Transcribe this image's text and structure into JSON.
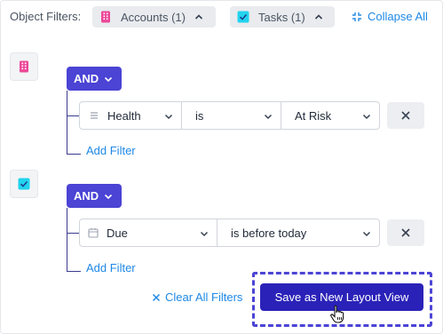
{
  "header": {
    "label": "Object Filters:",
    "chips": [
      {
        "label": "Accounts (1)",
        "icon": "building-icon",
        "color": "#ec4899"
      },
      {
        "label": "Tasks (1)",
        "icon": "checkbox-icon",
        "color": "#22d3ee"
      }
    ],
    "collapse_label": "Collapse All"
  },
  "groups": [
    {
      "object_icon": "building-icon",
      "operator": "AND",
      "filter": {
        "field": "Health",
        "field_icon": "list-icon",
        "op": "is",
        "value": "At Risk"
      },
      "add_label": "Add Filter"
    },
    {
      "object_icon": "checkbox-icon",
      "operator": "AND",
      "filter": {
        "field": "Due",
        "field_icon": "calendar-icon",
        "op": "is before today"
      },
      "add_label": "Add Filter"
    }
  ],
  "footer": {
    "clear_label": "Clear All Filters",
    "save_label": "Save as New Layout View"
  },
  "colors": {
    "accent": "#4b44d4",
    "save": "#2a22b8",
    "link": "#1e88e5"
  }
}
